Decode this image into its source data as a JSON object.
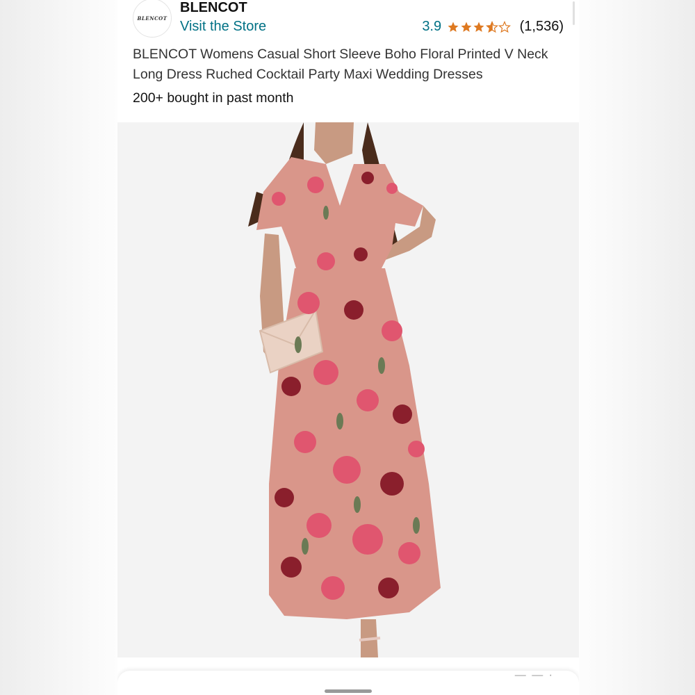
{
  "store": {
    "logo_text": "BLENCOT",
    "brand_name": "BLENCOT",
    "visit_label": "Visit the Store"
  },
  "rating": {
    "value": "3.9",
    "stars": 3.9,
    "review_count": "(1,536)"
  },
  "product": {
    "title": "BLENCOT Womens Casual Short Sleeve Boho Floral Printed V Neck Long Dress Ruched Cocktail Party Maxi Wedding Dresses",
    "bought_text": "200+ bought in past month"
  },
  "image": {
    "description_icon": "product-photo"
  },
  "bottom_sheet": {
    "peek_text": "— —  ·"
  },
  "colors": {
    "link": "#007185",
    "star": "#de7921",
    "dress_base": "#d9968a",
    "flower_pink": "#e0566f",
    "flower_dark": "#8a1f2c",
    "leaf": "#6b7a55"
  }
}
